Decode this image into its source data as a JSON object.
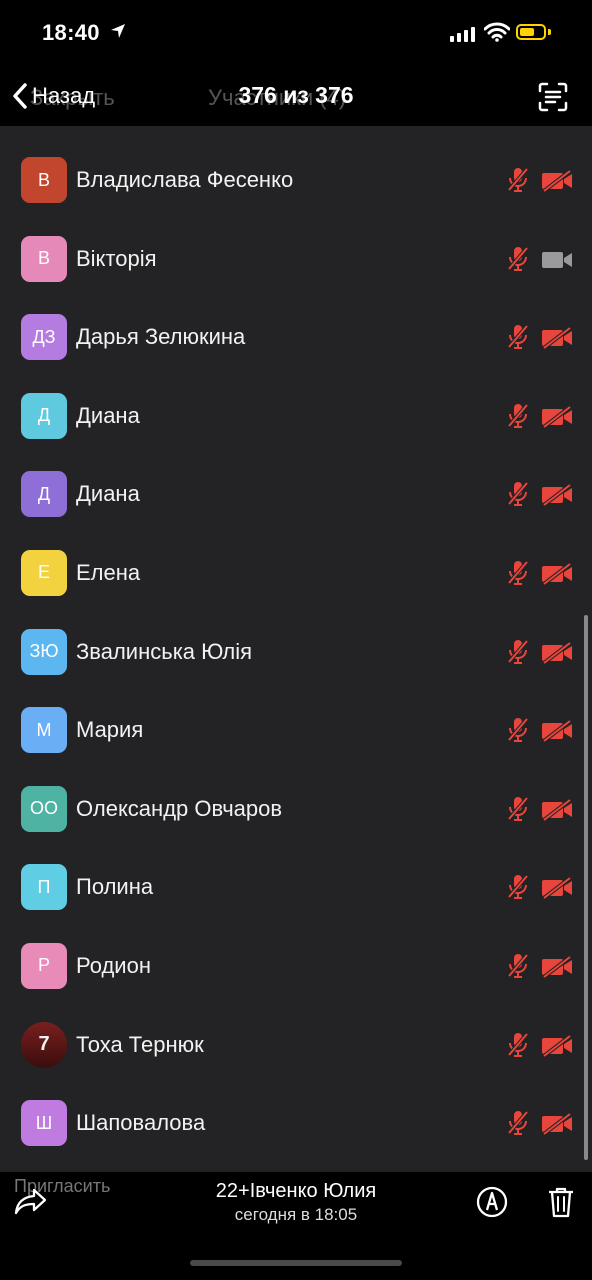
{
  "status": {
    "time": "18:40"
  },
  "nav": {
    "back_label": "Назад",
    "title": "376 из 376",
    "ghost_left": "Закрыть",
    "ghost_title": "Участники (4)"
  },
  "participants": [
    {
      "initials": "В",
      "name": "Владислава Фесенко",
      "color": "#c2452d",
      "video_on": false
    },
    {
      "initials": "В",
      "name": "Вікторія",
      "color": "#e58ab8",
      "video_on": true
    },
    {
      "initials": "ДЗ",
      "name": "Дарья Зелюкина",
      "color": "#b47be0",
      "video_on": false
    },
    {
      "initials": "Д",
      "name": "Диана",
      "color": "#5fc9e0",
      "video_on": false
    },
    {
      "initials": "Д",
      "name": "Диана",
      "color": "#8e6fd8",
      "video_on": false
    },
    {
      "initials": "Е",
      "name": "Елена",
      "color": "#f2d33f",
      "video_on": false
    },
    {
      "initials": "ЗЮ",
      "name": "Звалинська Юлія",
      "color": "#5cb6f0",
      "video_on": false
    },
    {
      "initials": "М",
      "name": "Мария",
      "color": "#6aaef5",
      "video_on": false
    },
    {
      "initials": "ОО",
      "name": "Олександр Овчаров",
      "color": "#4fb3a3",
      "video_on": false
    },
    {
      "initials": "П",
      "name": "Полина",
      "color": "#5fcde3",
      "video_on": false
    },
    {
      "initials": "Р",
      "name": "Родион",
      "color": "#e98bb9",
      "video_on": false
    },
    {
      "initials": "7",
      "name": "Тоха Тернюк",
      "color": "#7a1f1f",
      "video_on": false,
      "photo": true
    },
    {
      "initials": "Ш",
      "name": "Шаповалова",
      "color": "#c07be0",
      "video_on": false
    }
  ],
  "bottom": {
    "invite_ghost": "Пригласить",
    "message_title": "22+Івченко Юлия",
    "message_time": "сегодня в 18:05"
  },
  "colors": {
    "muted": "#e8453c",
    "cam_on": "#9a9a9c"
  }
}
